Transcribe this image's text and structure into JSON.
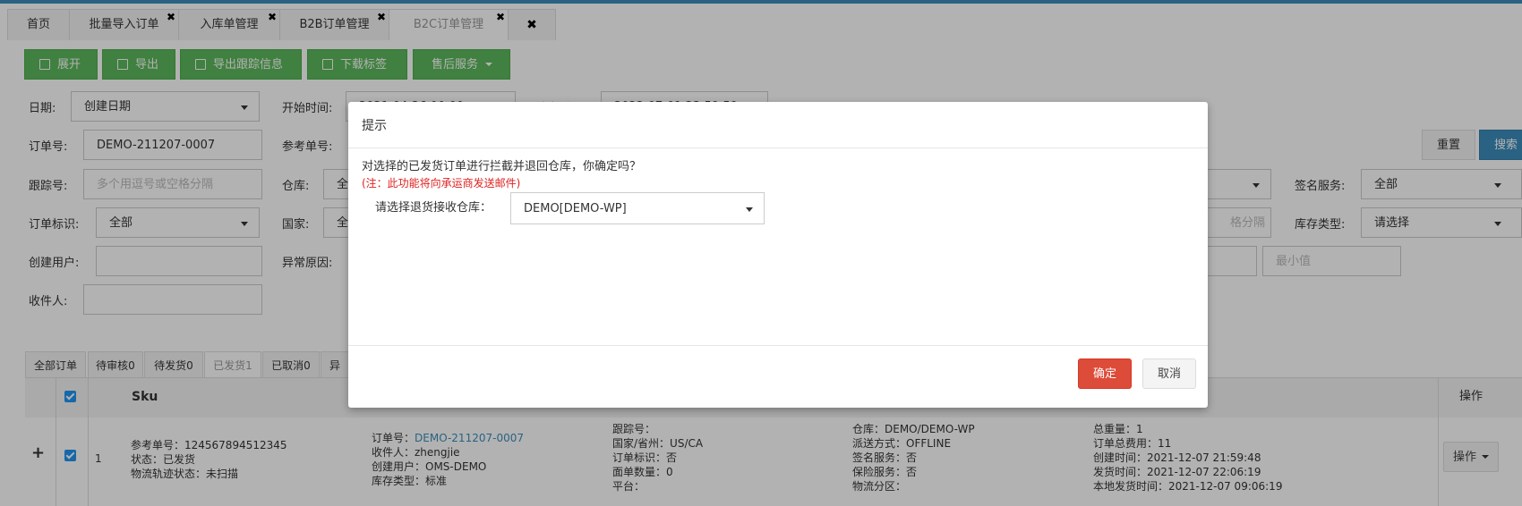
{
  "tabs": [
    {
      "label": "首页",
      "closable": false
    },
    {
      "label": "批量导入订单",
      "closable": true
    },
    {
      "label": "入库单管理",
      "closable": true
    },
    {
      "label": "B2B订单管理",
      "closable": true
    },
    {
      "label": "B2C订单管理",
      "closable": true,
      "active": true
    }
  ],
  "tab_close_all": "✖",
  "tab_close": "✖",
  "toolbar": {
    "expand": "展开",
    "export": "导出",
    "export_tracking": "导出跟踪信息",
    "download_label": "下载标签",
    "after_sales": "售后服务"
  },
  "filters": {
    "date_label": "日期:",
    "date_value": "创建日期",
    "start_label": "开始时间:",
    "start_value": "2021-04-26 00:00",
    "end_label": "结束时间:",
    "end_value": "2022-07-01 23:59:59",
    "order_no_label": "订单号:",
    "order_no_value": "DEMO-211207-0007",
    "ref_no_label": "参考单号:",
    "tracking_label": "跟踪号:",
    "tracking_placeholder": "多个用逗号或空格分隔",
    "warehouse_label": "仓库:",
    "warehouse_value": "全",
    "sign_label": "签名服务:",
    "sign_value": "全部",
    "order_flag_label": "订单标识:",
    "order_flag_value": "全部",
    "country_label": "国家:",
    "country_value": "全",
    "stock_type_label": "库存类型:",
    "stock_type_value": "请选择",
    "partial_placeholder": "格分隔",
    "creator_label": "创建用户:",
    "exception_label": "异常原因:",
    "min_placeholder": "最小值",
    "receiver_label": "收件人:",
    "reset": "重置",
    "search": "搜索"
  },
  "status_tabs": [
    "全部订单",
    "待审核0",
    "待发货0",
    "已发货1",
    "已取消0",
    "异"
  ],
  "table": {
    "col_sku": "Sku",
    "col_action": "操作",
    "row": {
      "expand": "+",
      "index": "1",
      "ref_line": "参考单号：124567894512345",
      "status_line": "状态：已发货",
      "logistics_line": "物流轨迹状态：未扫描",
      "order_label": "订单号：",
      "order_value": "DEMO-211207-0007",
      "receiver_line": "收件人：zhengjie",
      "creator_line": "创建用户：OMS-DEMO",
      "stock_type_line": "库存类型：标准",
      "tracking_line": "跟踪号：",
      "country_line": "国家/省州：US/CA",
      "flag_line": "订单标识：否",
      "sheet_count_line": "面单数量：0",
      "platform_line": "平台：",
      "warehouse_line": "仓库：DEMO/DEMO-WP",
      "ship_method_line": "派送方式：OFFLINE",
      "sign_line": "签名服务：否",
      "insurance_line": "保险服务：否",
      "zone_line": "物流分区：",
      "weight_line": "总重量：1",
      "total_fee_line": "订单总费用：11",
      "created_line": "创建时间：2021-12-07 21:59:48",
      "shipped_line": "发货时间：2021-12-07 22:06:19",
      "local_ship_line": "本地发货时间：2021-12-07 09:06:19",
      "action_btn": "操作"
    }
  },
  "modal": {
    "title": "提示",
    "message": "对选择的已发货订单进行拦截并退回仓库，你确定吗？",
    "note": "(注：此功能将向承运商发送邮件)",
    "return_label": "请选择退货接收仓库：",
    "return_value": "DEMO[DEMO-WP]",
    "confirm": "确定",
    "cancel": "取消"
  }
}
